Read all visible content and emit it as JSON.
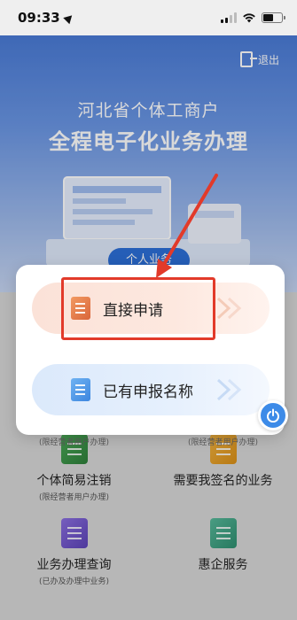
{
  "status_bar": {
    "time": "09:33"
  },
  "header": {
    "logout_label": "退出"
  },
  "banner": {
    "title_line1": "河北省个体工商户",
    "title_line2": "全程电子化业务办理",
    "tab_label": "个人业务"
  },
  "modal": {
    "options": [
      {
        "label": "直接申请",
        "icon": "orange-document-icon"
      },
      {
        "label": "已有申报名称",
        "icon": "blue-document-icon"
      }
    ]
  },
  "grid": {
    "items": [
      {
        "name": "个体简易注销",
        "sub": "(限经营者用户办理)",
        "icon": "green-folder-icon"
      },
      {
        "name": "需要我签名的业务",
        "sub": "",
        "icon": "orange-document-icon"
      },
      {
        "name": "业务办理查询",
        "sub": "(已办及办理中业务)",
        "icon": "purple-briefcase-icon"
      },
      {
        "name": "惠企服务",
        "sub": "",
        "icon": "certificate-icon"
      }
    ],
    "partial_subs": [
      "(限经营者用户办理)",
      "(限经营者用户办理)"
    ]
  },
  "colors": {
    "highlight": "#e23a2a",
    "banner_blue": "#4a7bd7",
    "accent_blue": "#3d8be8"
  }
}
